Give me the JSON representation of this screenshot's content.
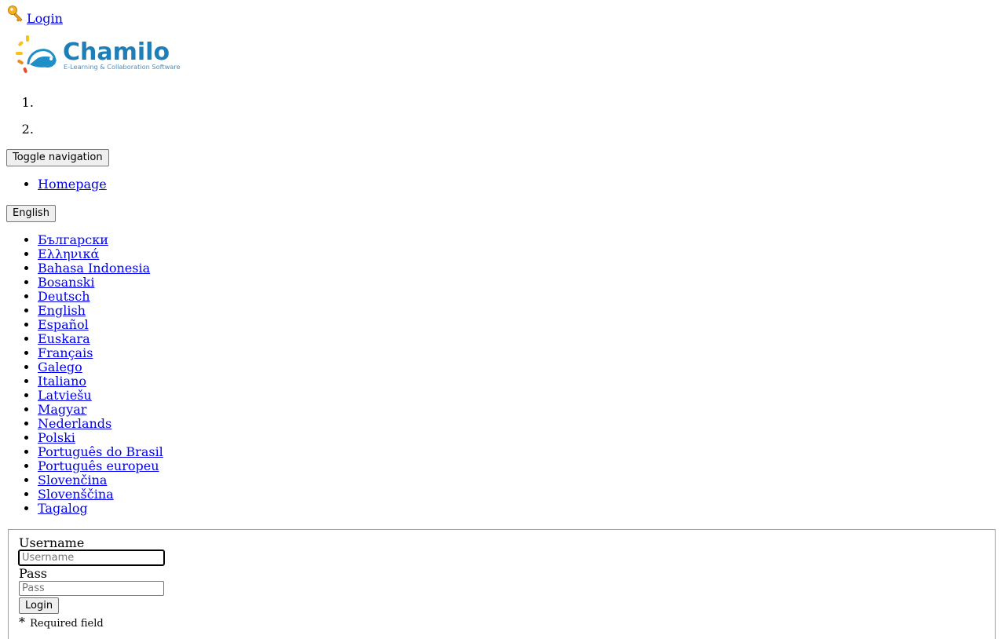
{
  "header": {
    "login_link": "Login",
    "key_icon": "key-icon"
  },
  "logo": {
    "name": "Chamilo",
    "tagline": "E-Learning & Collaboration Software",
    "colors": {
      "wordmark": "#1e7fb8",
      "tagline": "#4a8fc0",
      "chameleon": "#1e8fc8",
      "ray_yellow": "#f4c21a",
      "ray_orange": "#f08a1c",
      "ray_red": "#e84b2b"
    }
  },
  "steps": [
    "",
    ""
  ],
  "nav": {
    "toggle_label": "Toggle navigation",
    "items": [
      "Homepage"
    ]
  },
  "language": {
    "selected": "English",
    "options": [
      "Български",
      "Ελληνικά",
      "Bahasa Indonesia",
      "Bosanski",
      "Deutsch",
      "English",
      "Español",
      "Euskara",
      "Français",
      "Galego",
      "Italiano",
      "Latviešu",
      "Magyar",
      "Nederlands",
      "Polski",
      "Português do Brasil",
      "Português europeu",
      "Slovenčina",
      "Slovenščina",
      "Tagalog"
    ]
  },
  "login_form": {
    "username_label": "Username",
    "username_placeholder": "Username",
    "username_value": "",
    "pass_label": "Pass",
    "pass_placeholder": "Pass",
    "pass_value": "",
    "submit_label": "Login",
    "required_star": "*",
    "required_text": "Required field"
  }
}
